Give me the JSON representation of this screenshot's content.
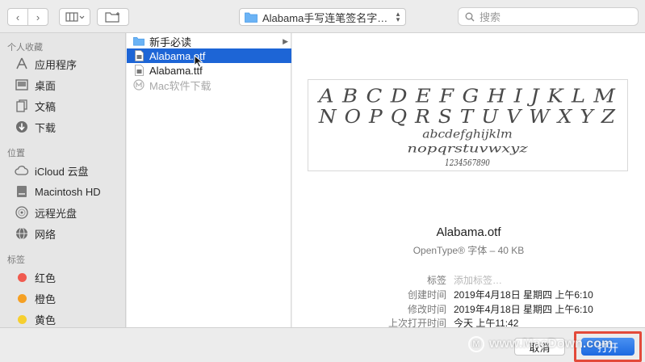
{
  "toolbar": {
    "back_icon": "‹",
    "forward_icon": "›",
    "view_icon": "column-view",
    "new_folder_icon": "new-folder",
    "location": "Alabama手写连笔签名字…",
    "search_placeholder": "搜索"
  },
  "sidebar": {
    "favorites_title": "个人收藏",
    "favorites": [
      {
        "label": "应用程序",
        "icon": "applications-icon"
      },
      {
        "label": "桌面",
        "icon": "desktop-icon"
      },
      {
        "label": "文稿",
        "icon": "documents-icon"
      },
      {
        "label": "下载",
        "icon": "downloads-icon"
      }
    ],
    "locations_title": "位置",
    "locations": [
      {
        "label": "iCloud 云盘",
        "icon": "cloud-icon"
      },
      {
        "label": "Macintosh HD",
        "icon": "disk-icon"
      },
      {
        "label": "远程光盘",
        "icon": "optical-disc-icon"
      },
      {
        "label": "网络",
        "icon": "network-icon"
      }
    ],
    "tags_title": "标签",
    "tags": [
      {
        "label": "红色",
        "color": "#f05a4f"
      },
      {
        "label": "橙色",
        "color": "#f5a023"
      },
      {
        "label": "黄色",
        "color": "#f6cf2f"
      }
    ]
  },
  "files": [
    {
      "name": "新手必读",
      "kind": "folder"
    },
    {
      "name": "Alabama.otf",
      "kind": "font",
      "selected": true
    },
    {
      "name": "Alabama.ttf",
      "kind": "font"
    },
    {
      "name": "Mac软件下载",
      "kind": "link",
      "dimmed": true
    }
  ],
  "preview": {
    "sample_lines": [
      "A B C D E F G H I J K L M",
      "N O P Q R S T U V W X Y Z",
      "abcdefghijklm",
      "nopqrstuvwxyz",
      "1234567890"
    ],
    "file_name": "Alabama.otf",
    "file_kind": "OpenType® 字体 – 40 KB",
    "meta": [
      {
        "key": "标签",
        "value": "添加标签…",
        "placeholder": true
      },
      {
        "key": "创建时间",
        "value": "2019年4月18日 星期四 上午6:10"
      },
      {
        "key": "修改时间",
        "value": "2019年4月18日 星期四 上午6:10"
      },
      {
        "key": "上次打开时间",
        "value": "今天 上午11:42"
      }
    ]
  },
  "footer": {
    "cancel_label": "取消",
    "open_label": "打开",
    "highlight_color": "#e34a3a"
  },
  "watermark": {
    "text": "www.MacDown.com"
  }
}
